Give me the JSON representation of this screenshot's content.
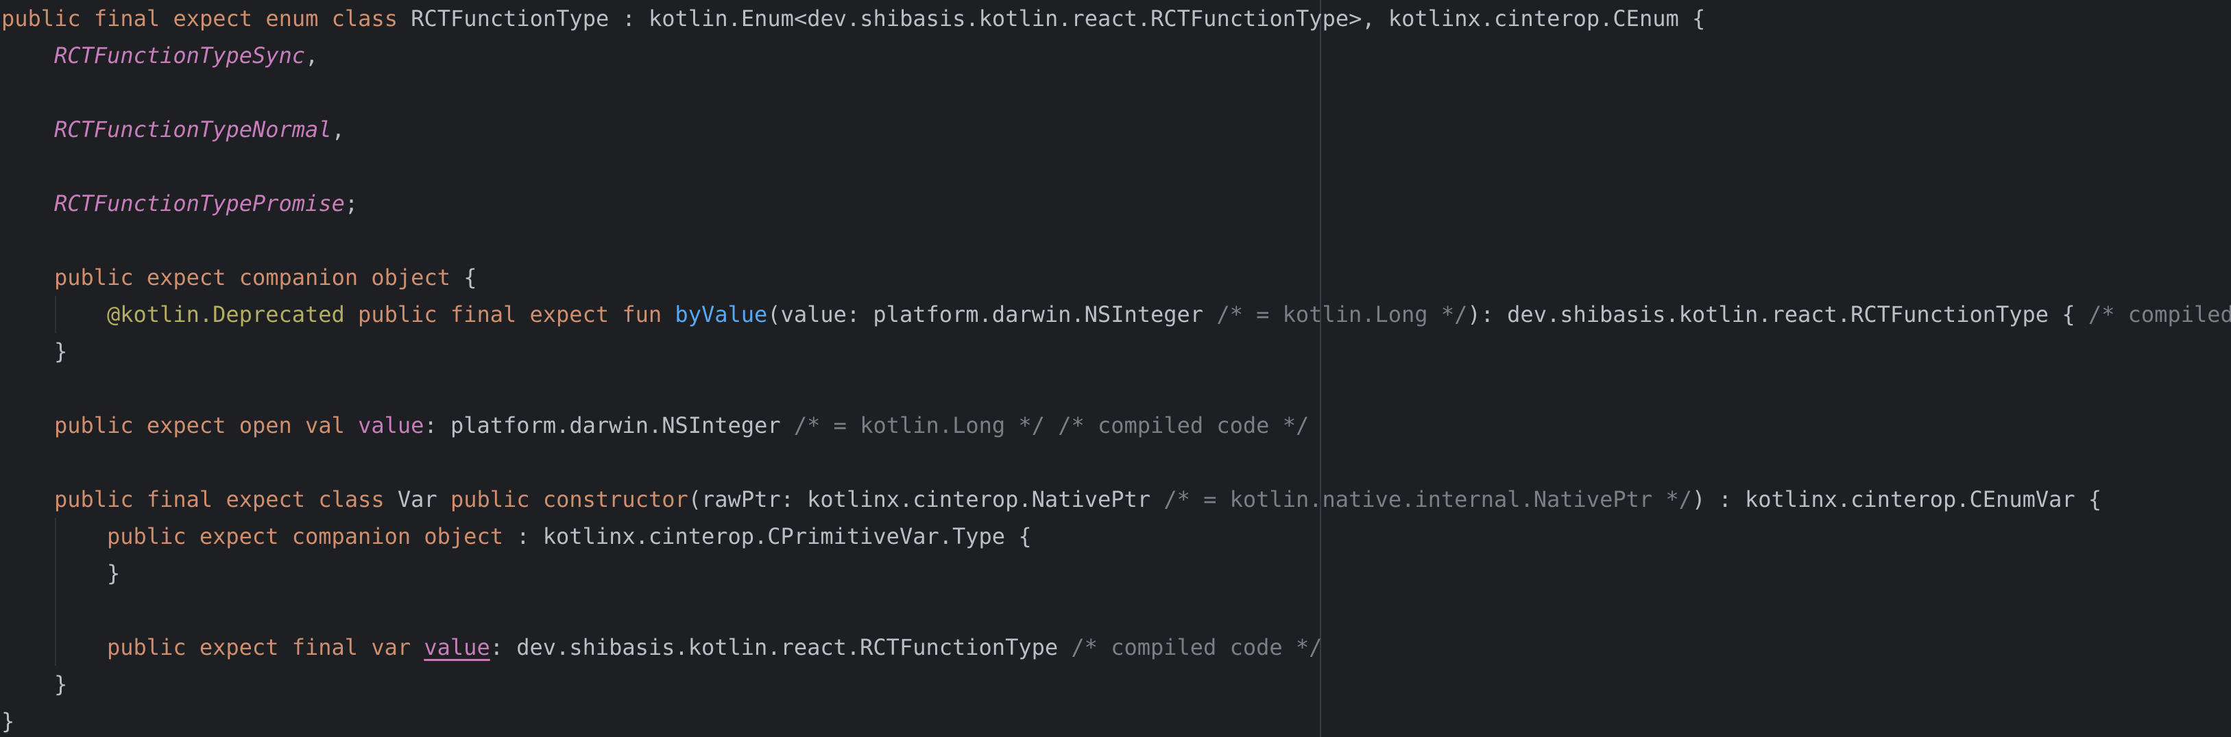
{
  "editor": {
    "lines": [
      {
        "indent": 0,
        "tokens": [
          {
            "t": "public final expect enum class",
            "k": "kw"
          },
          {
            "t": " RCTFunctionType : kotlin.Enum<dev.shibasis.kotlin.react.RCTFunctionType>, kotlinx.cinterop.CEnum {",
            "k": "txt"
          }
        ]
      },
      {
        "indent": 1,
        "tokens": [
          {
            "t": "RCTFunctionTypeSync",
            "k": "const"
          },
          {
            "t": ",",
            "k": "txt"
          }
        ]
      },
      {
        "indent": 0,
        "tokens": []
      },
      {
        "indent": 1,
        "tokens": [
          {
            "t": "RCTFunctionTypeNormal",
            "k": "const"
          },
          {
            "t": ",",
            "k": "txt"
          }
        ]
      },
      {
        "indent": 0,
        "tokens": []
      },
      {
        "indent": 1,
        "tokens": [
          {
            "t": "RCTFunctionTypePromise",
            "k": "const"
          },
          {
            "t": ";",
            "k": "txt"
          }
        ]
      },
      {
        "indent": 0,
        "tokens": []
      },
      {
        "indent": 1,
        "tokens": [
          {
            "t": "public expect companion object",
            "k": "kw"
          },
          {
            "t": " {",
            "k": "txt"
          }
        ]
      },
      {
        "indent": 2,
        "tokens": [
          {
            "t": "@kotlin.Deprecated",
            "k": "ann"
          },
          {
            "t": " ",
            "k": "txt"
          },
          {
            "t": "public final expect fun",
            "k": "kw"
          },
          {
            "t": " ",
            "k": "txt"
          },
          {
            "t": "byValue",
            "k": "fn"
          },
          {
            "t": "(value: platform.darwin.NSInteger ",
            "k": "txt"
          },
          {
            "t": "/* = kotlin.Long */",
            "k": "cmt"
          },
          {
            "t": "): dev.shibasis.kotlin.react.RCTFunctionType { ",
            "k": "txt"
          },
          {
            "t": "/* compiled",
            "k": "cmt"
          }
        ]
      },
      {
        "indent": 1,
        "tokens": [
          {
            "t": "}",
            "k": "txt"
          }
        ]
      },
      {
        "indent": 0,
        "tokens": []
      },
      {
        "indent": 1,
        "tokens": [
          {
            "t": "public expect open val",
            "k": "kw"
          },
          {
            "t": " ",
            "k": "txt"
          },
          {
            "t": "value",
            "k": "prop"
          },
          {
            "t": ": platform.darwin.NSInteger ",
            "k": "txt"
          },
          {
            "t": "/* = kotlin.Long */ /* compiled code */",
            "k": "cmt"
          }
        ]
      },
      {
        "indent": 0,
        "tokens": []
      },
      {
        "indent": 1,
        "tokens": [
          {
            "t": "public final expect class",
            "k": "kw"
          },
          {
            "t": " Var ",
            "k": "txt"
          },
          {
            "t": "public constructor",
            "k": "kw"
          },
          {
            "t": "(rawPtr: kotlinx.cinterop.NativePtr ",
            "k": "txt"
          },
          {
            "t": "/* = kotlin.native.internal.NativePtr */",
            "k": "cmt"
          },
          {
            "t": ") : kotlinx.cinterop.CEnumVar {",
            "k": "txt"
          }
        ]
      },
      {
        "indent": 2,
        "tokens": [
          {
            "t": "public expect companion object",
            "k": "kw"
          },
          {
            "t": " : kotlinx.cinterop.CPrimitiveVar.Type {",
            "k": "txt"
          }
        ]
      },
      {
        "indent": 2,
        "tokens": [
          {
            "t": "}",
            "k": "txt"
          }
        ]
      },
      {
        "indent": 0,
        "tokens": []
      },
      {
        "indent": 2,
        "tokens": [
          {
            "t": "public expect final var",
            "k": "kw"
          },
          {
            "t": " ",
            "k": "txt"
          },
          {
            "t": "value",
            "k": "propul"
          },
          {
            "t": ": dev.shibasis.kotlin.react.RCTFunctionType ",
            "k": "txt"
          },
          {
            "t": "/* compiled code */",
            "k": "cmt"
          }
        ]
      },
      {
        "indent": 1,
        "tokens": [
          {
            "t": "}",
            "k": "txt"
          }
        ]
      },
      {
        "indent": 0,
        "tokens": [
          {
            "t": "}",
            "k": "txt"
          }
        ]
      }
    ]
  },
  "colors": {
    "background": "#1e1f22",
    "keyword": "#cf8e6d",
    "enum_constant": "#c77dbb",
    "function": "#56a8f5",
    "annotation": "#b3ae60",
    "comment": "#7a7e85",
    "text": "#bcbec4"
  }
}
